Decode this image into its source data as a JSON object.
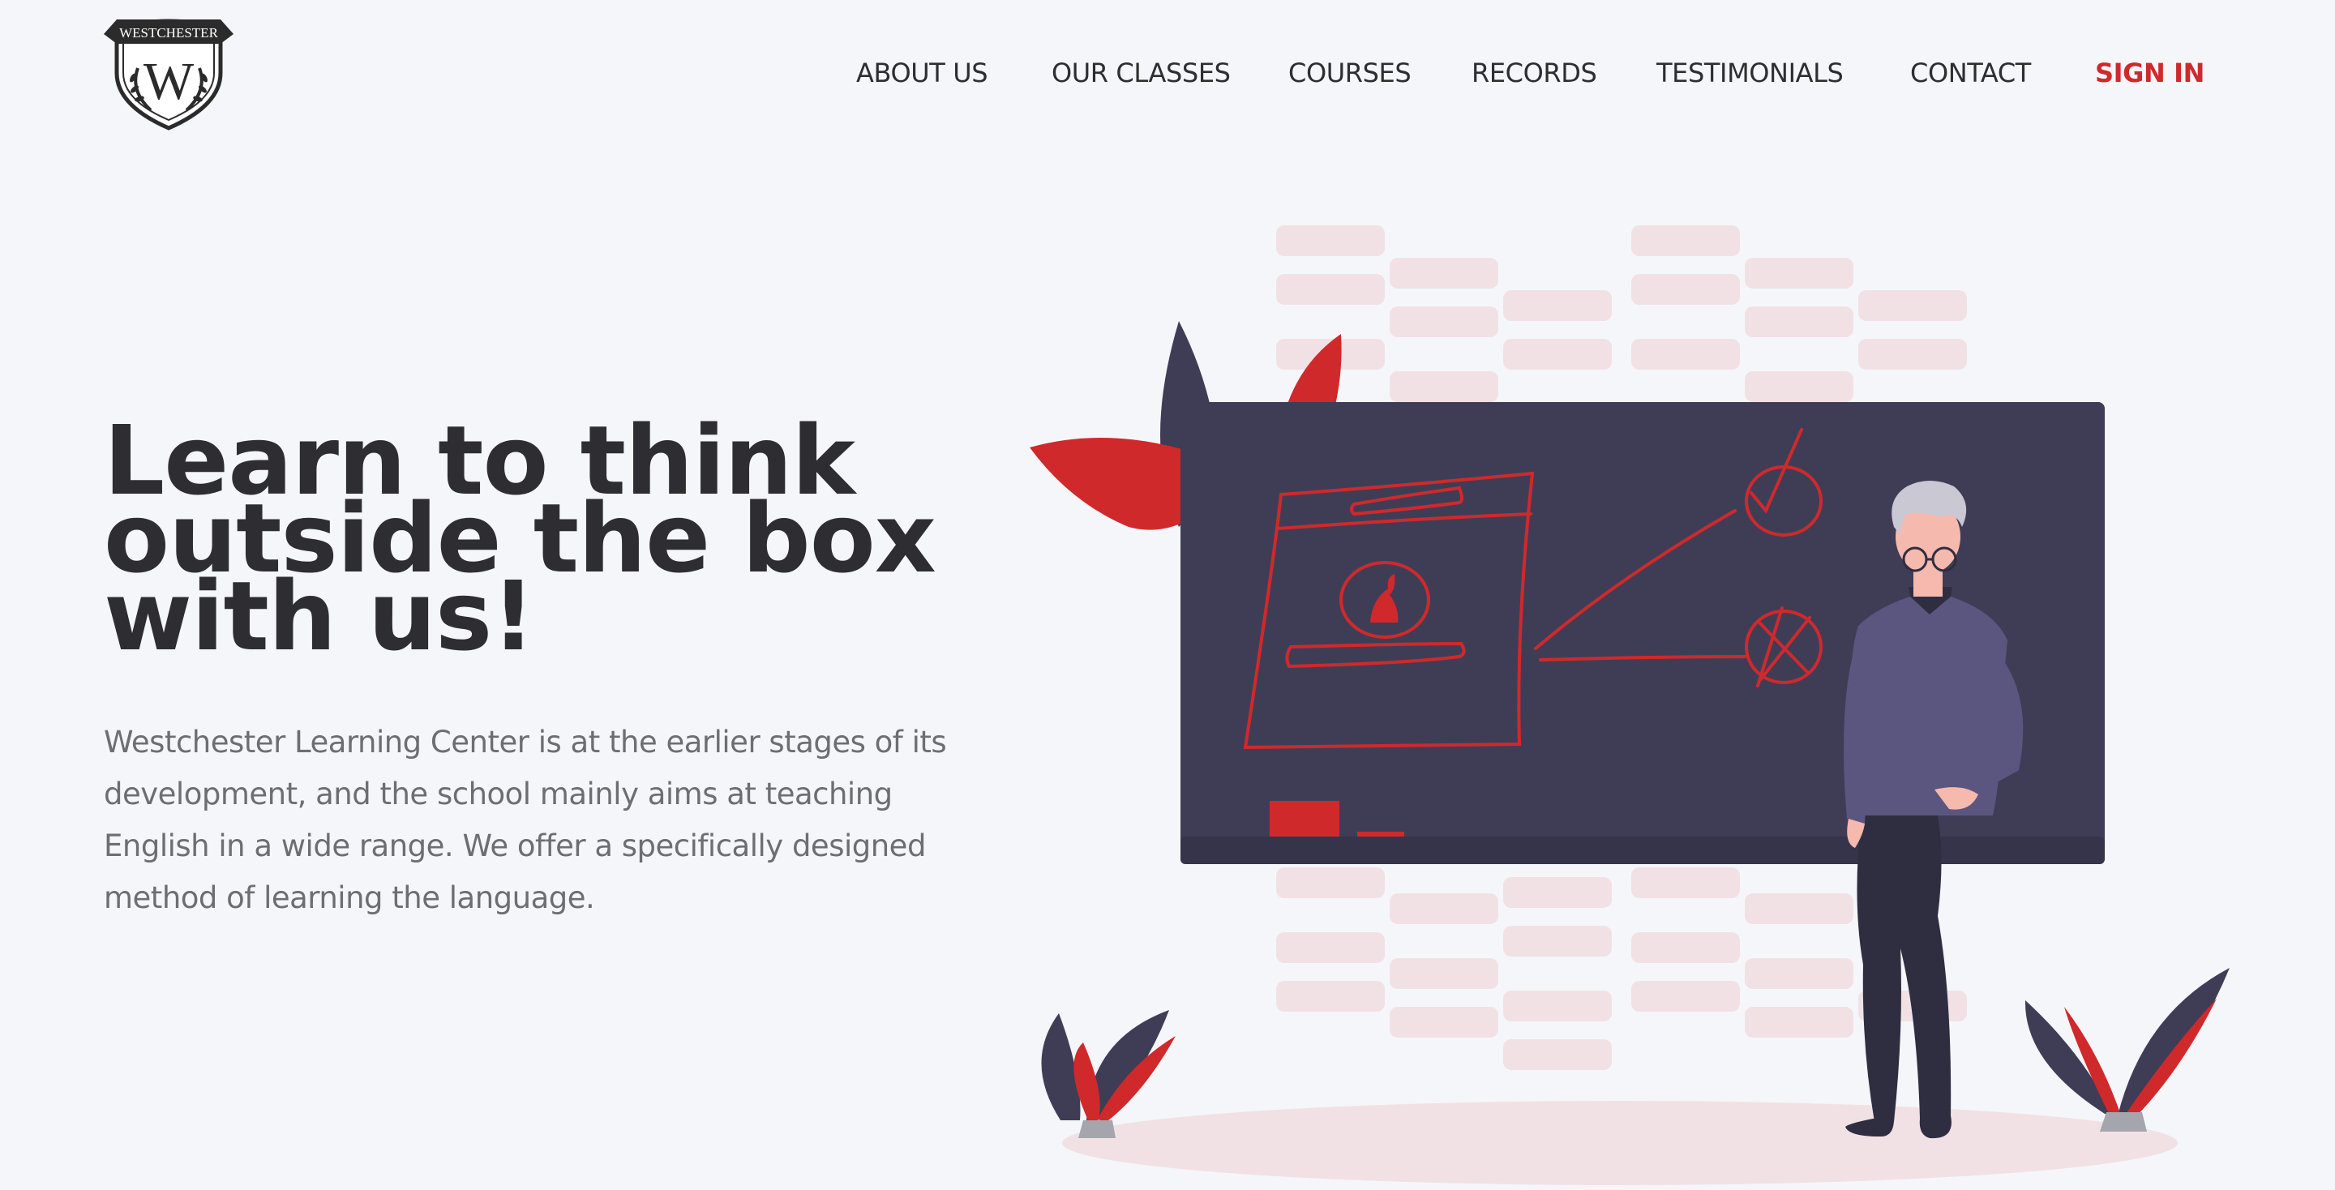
{
  "logo": {
    "text": "WESTCHESTER",
    "letter": "W"
  },
  "nav": {
    "items": [
      {
        "label": "ABOUT US"
      },
      {
        "label": "OUR CLASSES"
      },
      {
        "label": "COURSES"
      },
      {
        "label": "RECORDS"
      },
      {
        "label": "TESTIMONIALS"
      },
      {
        "label": "CONTACT"
      }
    ],
    "signin": "SIGN IN"
  },
  "hero": {
    "title_line1": "Learn to think",
    "title_line2": "outside the box",
    "title_line3": "with us!",
    "description": "Westchester Learning Center is at the earlier stages of its development, and the school mainly aims at teaching English in a wide range. We offer a specifically designed method of learning the language."
  },
  "colors": {
    "accent": "#d0292b",
    "dark": "#3f3d56",
    "text": "#2e2e32",
    "muted": "#6e6e72",
    "background": "#f5f6fa"
  }
}
